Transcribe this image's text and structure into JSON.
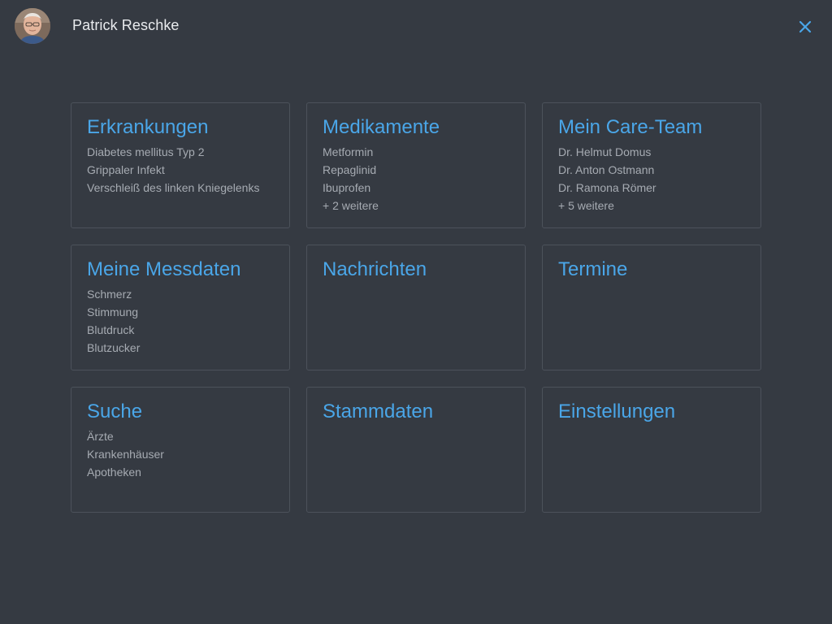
{
  "header": {
    "user_name": "Patrick Reschke",
    "avatar_icon": "user-photo-avatar",
    "close_icon": "close-icon",
    "accent_color": "#4aa6e8"
  },
  "cards": [
    {
      "title": "Erkrankungen",
      "items": [
        "Diabetes mellitus Typ 2",
        "Grippaler Infekt",
        "Verschleiß des linken Kniegelenks"
      ]
    },
    {
      "title": "Medikamente",
      "items": [
        "Metformin",
        "Repaglinid",
        "Ibuprofen",
        "+ 2 weitere"
      ]
    },
    {
      "title": "Mein Care-Team",
      "items": [
        "Dr. Helmut Domus",
        "Dr. Anton Ostmann",
        "Dr. Ramona Römer",
        "+ 5 weitere"
      ]
    },
    {
      "title": "Meine Messdaten",
      "items": [
        "Schmerz",
        "Stimmung",
        "Blutdruck",
        "Blutzucker"
      ]
    },
    {
      "title": "Nachrichten",
      "items": []
    },
    {
      "title": "Termine",
      "items": []
    },
    {
      "title": "Suche",
      "items": [
        "Ärzte",
        "Krankenhäuser",
        "Apotheken"
      ]
    },
    {
      "title": "Stammdaten",
      "items": []
    },
    {
      "title": "Einstellungen",
      "items": []
    }
  ]
}
